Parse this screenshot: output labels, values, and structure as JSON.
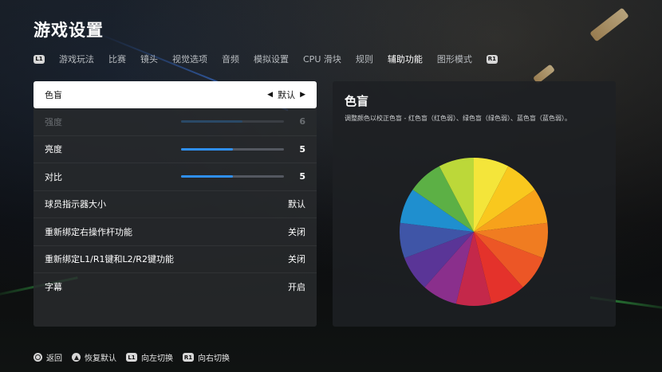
{
  "page": {
    "title": "游戏设置"
  },
  "tabs": {
    "left_key": "L1",
    "right_key": "R1",
    "items": [
      {
        "label": "游戏玩法"
      },
      {
        "label": "比赛"
      },
      {
        "label": "镜头"
      },
      {
        "label": "视觉选项"
      },
      {
        "label": "音频"
      },
      {
        "label": "模拟设置"
      },
      {
        "label": "CPU 滑块"
      },
      {
        "label": "规则"
      },
      {
        "label": "辅助功能",
        "active": true
      },
      {
        "label": "图形模式"
      }
    ]
  },
  "settings": {
    "colorblind": {
      "label": "色盲",
      "value": "默认"
    },
    "intensity": {
      "label": "强度",
      "value": "6",
      "level": 0.6,
      "disabled": true
    },
    "brightness": {
      "label": "亮度",
      "value": "5",
      "level": 0.5
    },
    "contrast": {
      "label": "对比",
      "value": "5",
      "level": 0.5
    },
    "player_indicator": {
      "label": "球员指示器大小",
      "value": "默认"
    },
    "rebind_right_stick": {
      "label": "重新绑定右操作杆功能",
      "value": "关闭"
    },
    "rebind_triggers": {
      "label": "重新绑定L1/R1键和L2/R2键功能",
      "value": "关闭"
    },
    "subtitles": {
      "label": "字幕",
      "value": "开启"
    }
  },
  "detail": {
    "title": "色盲",
    "description": "调整颜色以校正色盲 - 红色盲（红色弱）、绿色盲（绿色弱）、蓝色盲（蓝色弱）。",
    "wheel_colors": [
      "#f4e53a",
      "#f9c81e",
      "#f7a21b",
      "#f07c21",
      "#ec5626",
      "#e4322b",
      "#c4284a",
      "#8a2f8c",
      "#5a3597",
      "#3f55a7",
      "#1f8fcf",
      "#5cb045",
      "#bcd839"
    ]
  },
  "footer": {
    "back_label": "返回",
    "reset_label": "恢复默认",
    "left_switch_key": "L1",
    "left_switch_label": "向左切换",
    "right_switch_key": "R1",
    "right_switch_label": "向右切换"
  }
}
